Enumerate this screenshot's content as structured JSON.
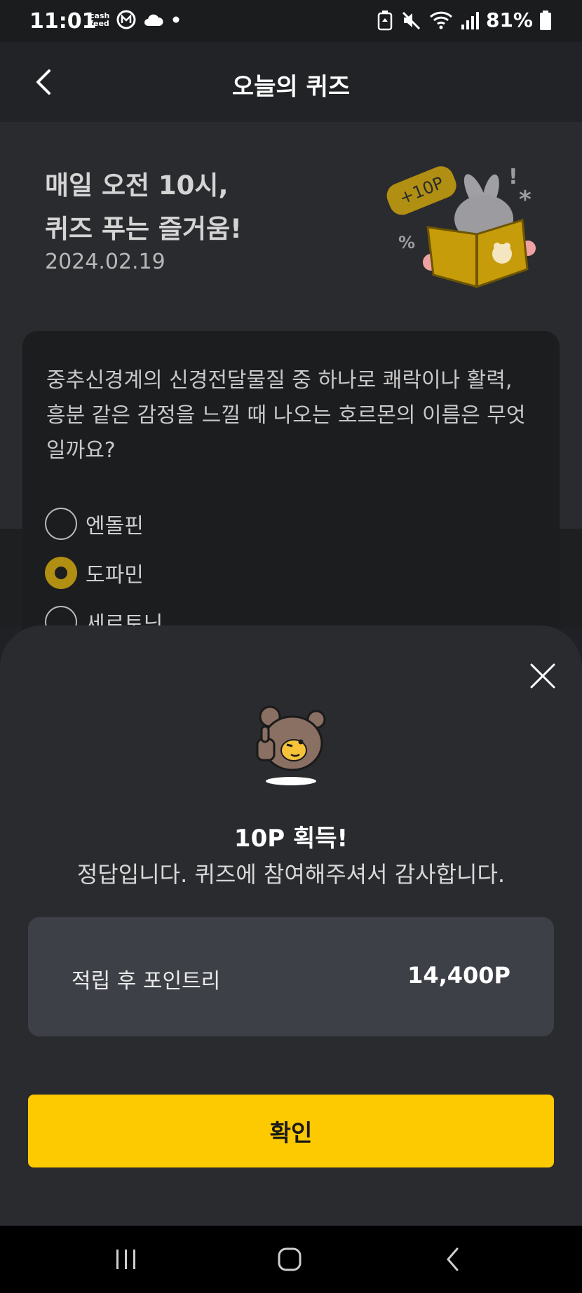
{
  "status_bar": {
    "time": "11:01",
    "cashfeed_label_top": "cash",
    "cashfeed_label_bottom": "feed",
    "battery_percent": "81%"
  },
  "app_bar": {
    "title": "오늘의 퀴즈"
  },
  "header": {
    "headline_line1": "매일 오전 10시,",
    "headline_line2": "퀴즈 푸는 즐거움!",
    "date": "2024.02.19",
    "badge_text": "+10P"
  },
  "quiz": {
    "question": "중추신경계의 신경전달물질 중 하나로 쾌락이나 활력, 흥분 같은 감정을 느낄 때 나오는 호르몬의 이름은 무엇일까요?",
    "options": [
      {
        "label": "엔돌핀",
        "selected": false
      },
      {
        "label": "도파민",
        "selected": true
      },
      {
        "label": "세로토닌",
        "selected": false
      }
    ]
  },
  "result_sheet": {
    "title": "10P 획득!",
    "message": "정답입니다. 퀴즈에 참여해주셔서 감사합니다.",
    "points_label": "적립 후 포인트리",
    "points_value": "14,400P",
    "confirm_label": "확인"
  },
  "colors": {
    "accent": "#fdc900",
    "selected_radio": "#b08f12",
    "sheet_bg": "#2a2b2f",
    "points_box_bg": "#3e4048"
  }
}
